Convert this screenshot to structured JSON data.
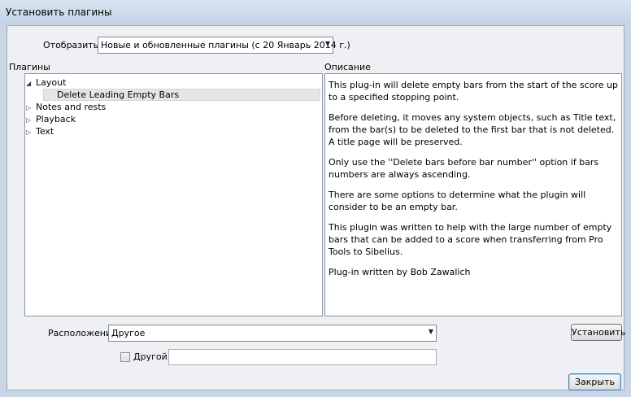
{
  "window": {
    "title": "Установить плагины"
  },
  "filter": {
    "label": "Отобразить:",
    "selected": "Новые и обновленные плагины (с 20 Январь 2014 г.)"
  },
  "plugins_panel": {
    "header": "Плагины",
    "tree": [
      {
        "label": "Layout",
        "expanded": true
      },
      {
        "label": "Delete Leading Empty Bars",
        "selected": true
      },
      {
        "label": "Notes and rests",
        "expanded": false
      },
      {
        "label": "Playback",
        "expanded": false
      },
      {
        "label": "Text",
        "expanded": false
      }
    ]
  },
  "description_panel": {
    "header": "Описание",
    "paragraphs": [
      "This plug-in will delete empty bars from the start of the score up to a specified stopping point.",
      "Before deleting, it moves any system objects, such as Title text, from the bar(s) to be deleted to the first bar that is not deleted. A title page will be preserved.",
      "Only use the ''Delete bars before bar number'' option if bars numbers are always ascending.",
      "There are some options to determine what the plugin will consider to be an empty bar.",
      "This plugin was written to help with the large number of empty bars that can be added to a score when transferring from Pro Tools to Sibelius.",
      "Plug-in written by Bob Zawalich"
    ]
  },
  "location": {
    "label": "Расположение",
    "selected": "Другое"
  },
  "other": {
    "checkbox_label": "Другой:",
    "value": ""
  },
  "buttons": {
    "install": "Установить",
    "close": "Закрыть"
  },
  "icons": {
    "tree_expanded": "triangle-down-icon",
    "tree_collapsed": "triangle-right-icon",
    "dropdown": "chevron-down-icon"
  }
}
